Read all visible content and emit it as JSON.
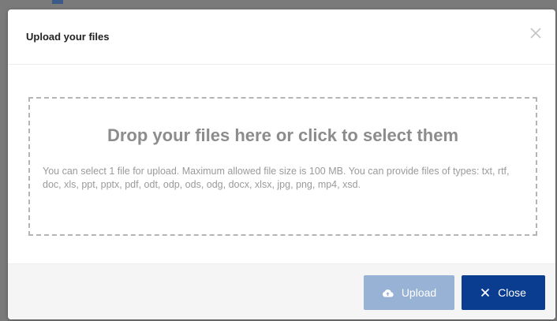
{
  "modal": {
    "title": "Upload your files"
  },
  "dropzone": {
    "title": "Drop your files here or click to select them",
    "info": "You can select 1 file for upload. Maximum allowed file size is 100 MB. You can provide files of types: txt, rtf, doc, xls, ppt, pptx, pdf, odt, odp, ods, odg, docx, xlsx, jpg, png, mp4, xsd."
  },
  "footer": {
    "upload_label": "Upload",
    "upload_icon": "cloud-upload-icon",
    "close_label": "Close",
    "close_icon": "close-icon"
  },
  "colors": {
    "upload_button_bg": "#97b2d5",
    "close_button_bg": "#0a3d8f",
    "overlay": "#7a7a7a"
  }
}
